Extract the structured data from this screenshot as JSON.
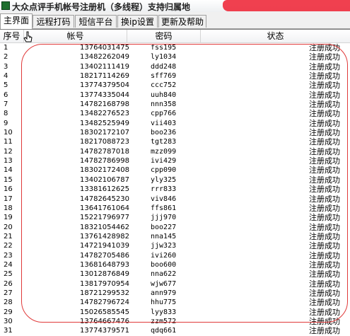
{
  "window": {
    "title": "大众点评手机帐号注册机（多线程）支持归属地"
  },
  "tabs": [
    "主界面",
    "远程打码",
    "短信平台",
    "换ip设置",
    "更新及帮助"
  ],
  "columns": {
    "no": "序号",
    "account": "帐号",
    "password": "密码",
    "status": "状态"
  },
  "rows": [
    {
      "no": "1",
      "account": "13764031475",
      "password": "fss195",
      "status": "注册成功"
    },
    {
      "no": "2",
      "account": "13482262049",
      "password": "ly1034",
      "status": "注册成功"
    },
    {
      "no": "3",
      "account": "13402111419",
      "password": "ddd248",
      "status": "注册成功"
    },
    {
      "no": "4",
      "account": "18217114269",
      "password": "sff769",
      "status": "注册成功"
    },
    {
      "no": "5",
      "account": "13774379504",
      "password": "ccc752",
      "status": "注册成功"
    },
    {
      "no": "6",
      "account": "13774335044",
      "password": "uuh840",
      "status": "注册成功"
    },
    {
      "no": "7",
      "account": "14782168798",
      "password": "nnn358",
      "status": "注册成功"
    },
    {
      "no": "8",
      "account": "13482276523",
      "password": "cpp766",
      "status": "注册成功"
    },
    {
      "no": "9",
      "account": "13482525949",
      "password": "vii403",
      "status": "注册成功"
    },
    {
      "no": "10",
      "account": "18302172107",
      "password": "boo236",
      "status": "注册成功"
    },
    {
      "no": "11",
      "account": "18217088723",
      "password": "tgt283",
      "status": "注册成功"
    },
    {
      "no": "12",
      "account": "14782787018",
      "password": "mzz099",
      "status": "注册成功"
    },
    {
      "no": "13",
      "account": "14782786998",
      "password": "ivi429",
      "status": "注册成功"
    },
    {
      "no": "14",
      "account": "18302172408",
      "password": "cpp090",
      "status": "注册成功"
    },
    {
      "no": "15",
      "account": "13402106787",
      "password": "yly325",
      "status": "注册成功"
    },
    {
      "no": "16",
      "account": "13381612625",
      "password": "rrr833",
      "status": "注册成功"
    },
    {
      "no": "17",
      "account": "14782645230",
      "password": "viv846",
      "status": "注册成功"
    },
    {
      "no": "18",
      "account": "13641761064",
      "password": "ffs861",
      "status": "注册成功"
    },
    {
      "no": "19",
      "account": "15221796977",
      "password": "jjj970",
      "status": "注册成功"
    },
    {
      "no": "20",
      "account": "18321054462",
      "password": "boo227",
      "status": "注册成功"
    },
    {
      "no": "21",
      "account": "13761428982",
      "password": "nna145",
      "status": "注册成功"
    },
    {
      "no": "22",
      "account": "14721941039",
      "password": "jjw323",
      "status": "注册成功"
    },
    {
      "no": "23",
      "account": "14782705486",
      "password": "ivi260",
      "status": "注册成功"
    },
    {
      "no": "24",
      "account": "13681648793",
      "password": "boo600",
      "status": "注册成功"
    },
    {
      "no": "25",
      "account": "13012876849",
      "password": "nna622",
      "status": "注册成功"
    },
    {
      "no": "26",
      "account": "13817970954",
      "password": "wjw677",
      "status": "注册成功"
    },
    {
      "no": "27",
      "account": "18721299532",
      "password": "ann979",
      "status": "注册成功"
    },
    {
      "no": "28",
      "account": "14782796724",
      "password": "hhu775",
      "status": "注册成功"
    },
    {
      "no": "29",
      "account": "15026585545",
      "password": "lyy833",
      "status": "注册成功"
    },
    {
      "no": "30",
      "account": "13764667476",
      "password": "zzm572",
      "status": "注册成功"
    },
    {
      "no": "31",
      "account": "13774379571",
      "password": "qdq661",
      "status": "注册成功"
    }
  ]
}
